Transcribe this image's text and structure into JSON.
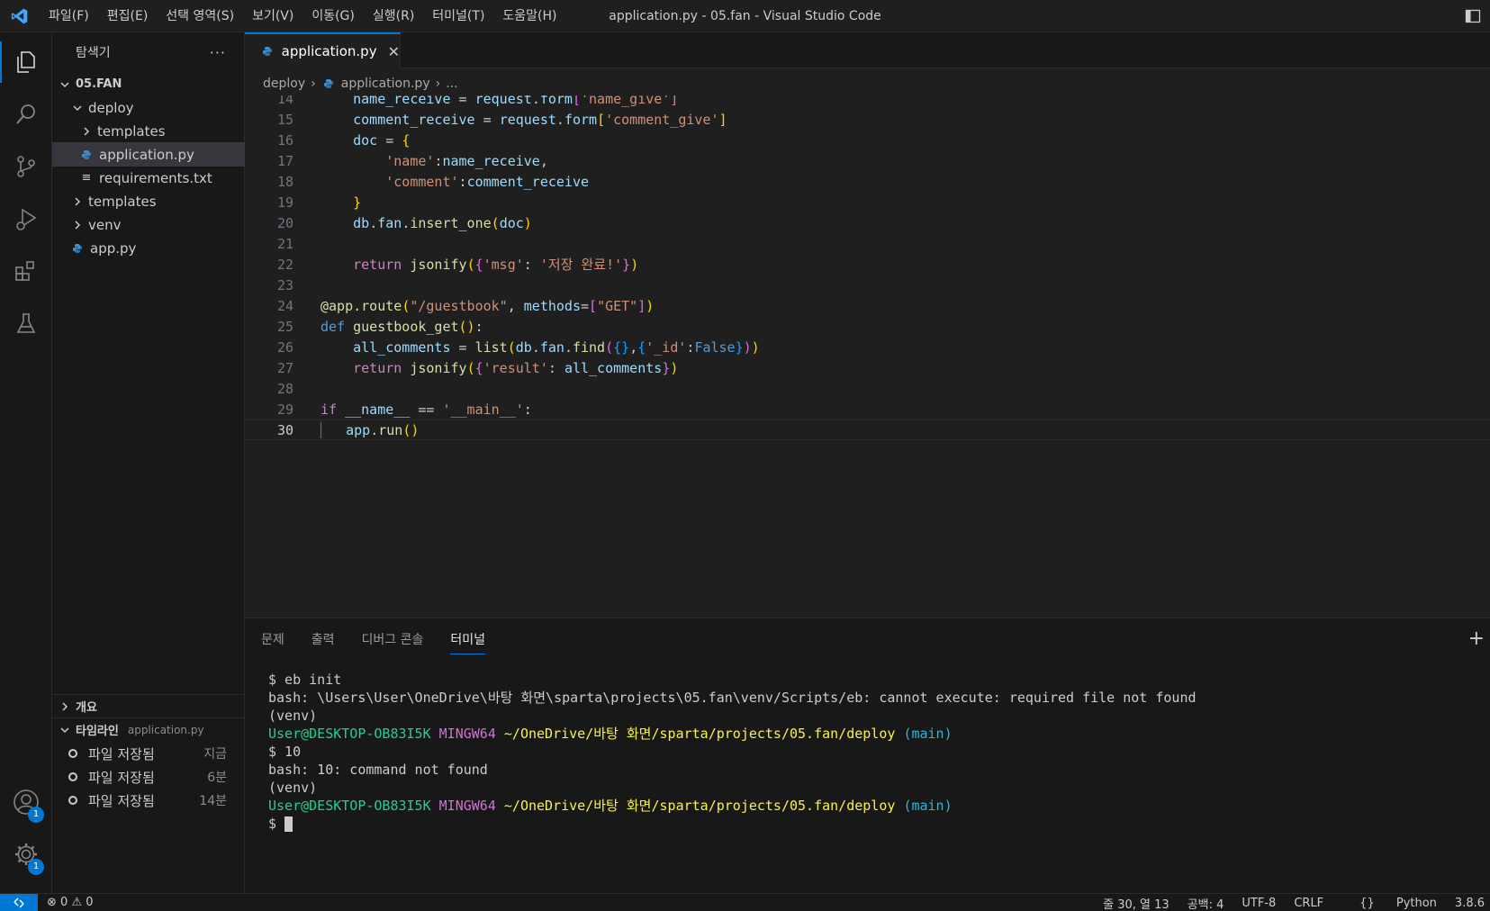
{
  "window": {
    "title": "application.py - 05.fan - Visual Studio Code",
    "menu": [
      "파일(F)",
      "편집(E)",
      "선택 영역(S)",
      "보기(V)",
      "이동(G)",
      "실행(R)",
      "터미널(T)",
      "도움말(H)"
    ]
  },
  "activity": {
    "items": [
      "explorer-icon",
      "search-icon",
      "source-control-icon",
      "run-debug-icon",
      "extensions-icon",
      "testing-icon"
    ],
    "accounts_badge": "1",
    "settings_badge": "1"
  },
  "sidebar": {
    "title": "탐색기",
    "more": "···",
    "root": "05.FAN",
    "tree": [
      {
        "label": "deploy",
        "type": "folder-open"
      },
      {
        "label": "templates",
        "type": "folder"
      },
      {
        "label": "application.py",
        "type": "python"
      },
      {
        "label": "requirements.txt",
        "type": "text"
      },
      {
        "label": "templates",
        "type": "folder"
      },
      {
        "label": "venv",
        "type": "folder"
      },
      {
        "label": "app.py",
        "type": "python"
      }
    ],
    "outline": "개요",
    "timeline": {
      "title": "타임라인",
      "file": "application.py",
      "items": [
        {
          "label": "파일 저장됨",
          "time": "지금"
        },
        {
          "label": "파일 저장됨",
          "time": "6분"
        },
        {
          "label": "파일 저장됨",
          "time": "14분"
        }
      ]
    }
  },
  "editor": {
    "tab": "application.py",
    "breadcrumb": [
      "deploy",
      "application.py",
      "..."
    ],
    "line_numbers": [
      "14",
      "15",
      "16",
      "17",
      "18",
      "19",
      "20",
      "21",
      "22",
      "23",
      "24",
      "25",
      "26",
      "27",
      "28",
      "29",
      "30"
    ],
    "current_line": "30"
  },
  "panel": {
    "tabs": [
      "문제",
      "출력",
      "디버그 콘솔",
      "터미널"
    ],
    "active_tab": "터미널",
    "terminal": {
      "line1": "$ eb init",
      "line2": "bash: \\Users\\User\\OneDrive\\바탕 화면\\sparta\\projects\\05.fan\\venv/Scripts/eb: cannot execute: required file not found",
      "line3": "(venv)",
      "prompt_user": "User@DESKTOP-OB83I5K",
      "prompt_host": "MINGW64",
      "prompt_path": "~/OneDrive/바탕 화면/sparta/projects/05.fan/deploy",
      "prompt_branch": "(main)",
      "line5": "$ 10",
      "line6": "bash: 10: command not found",
      "line7": "(venv)",
      "prompt_last": "$ "
    }
  },
  "status": {
    "problems": "0",
    "warnings": "0",
    "position": "줄 30, 열 13",
    "spaces": "공백: 4",
    "encoding": "UTF-8",
    "eol": "CRLF",
    "language": "Python",
    "version": "3.8.6"
  },
  "colors": {
    "accent": "#0078d4",
    "python_icon": "#3e8fd0"
  }
}
